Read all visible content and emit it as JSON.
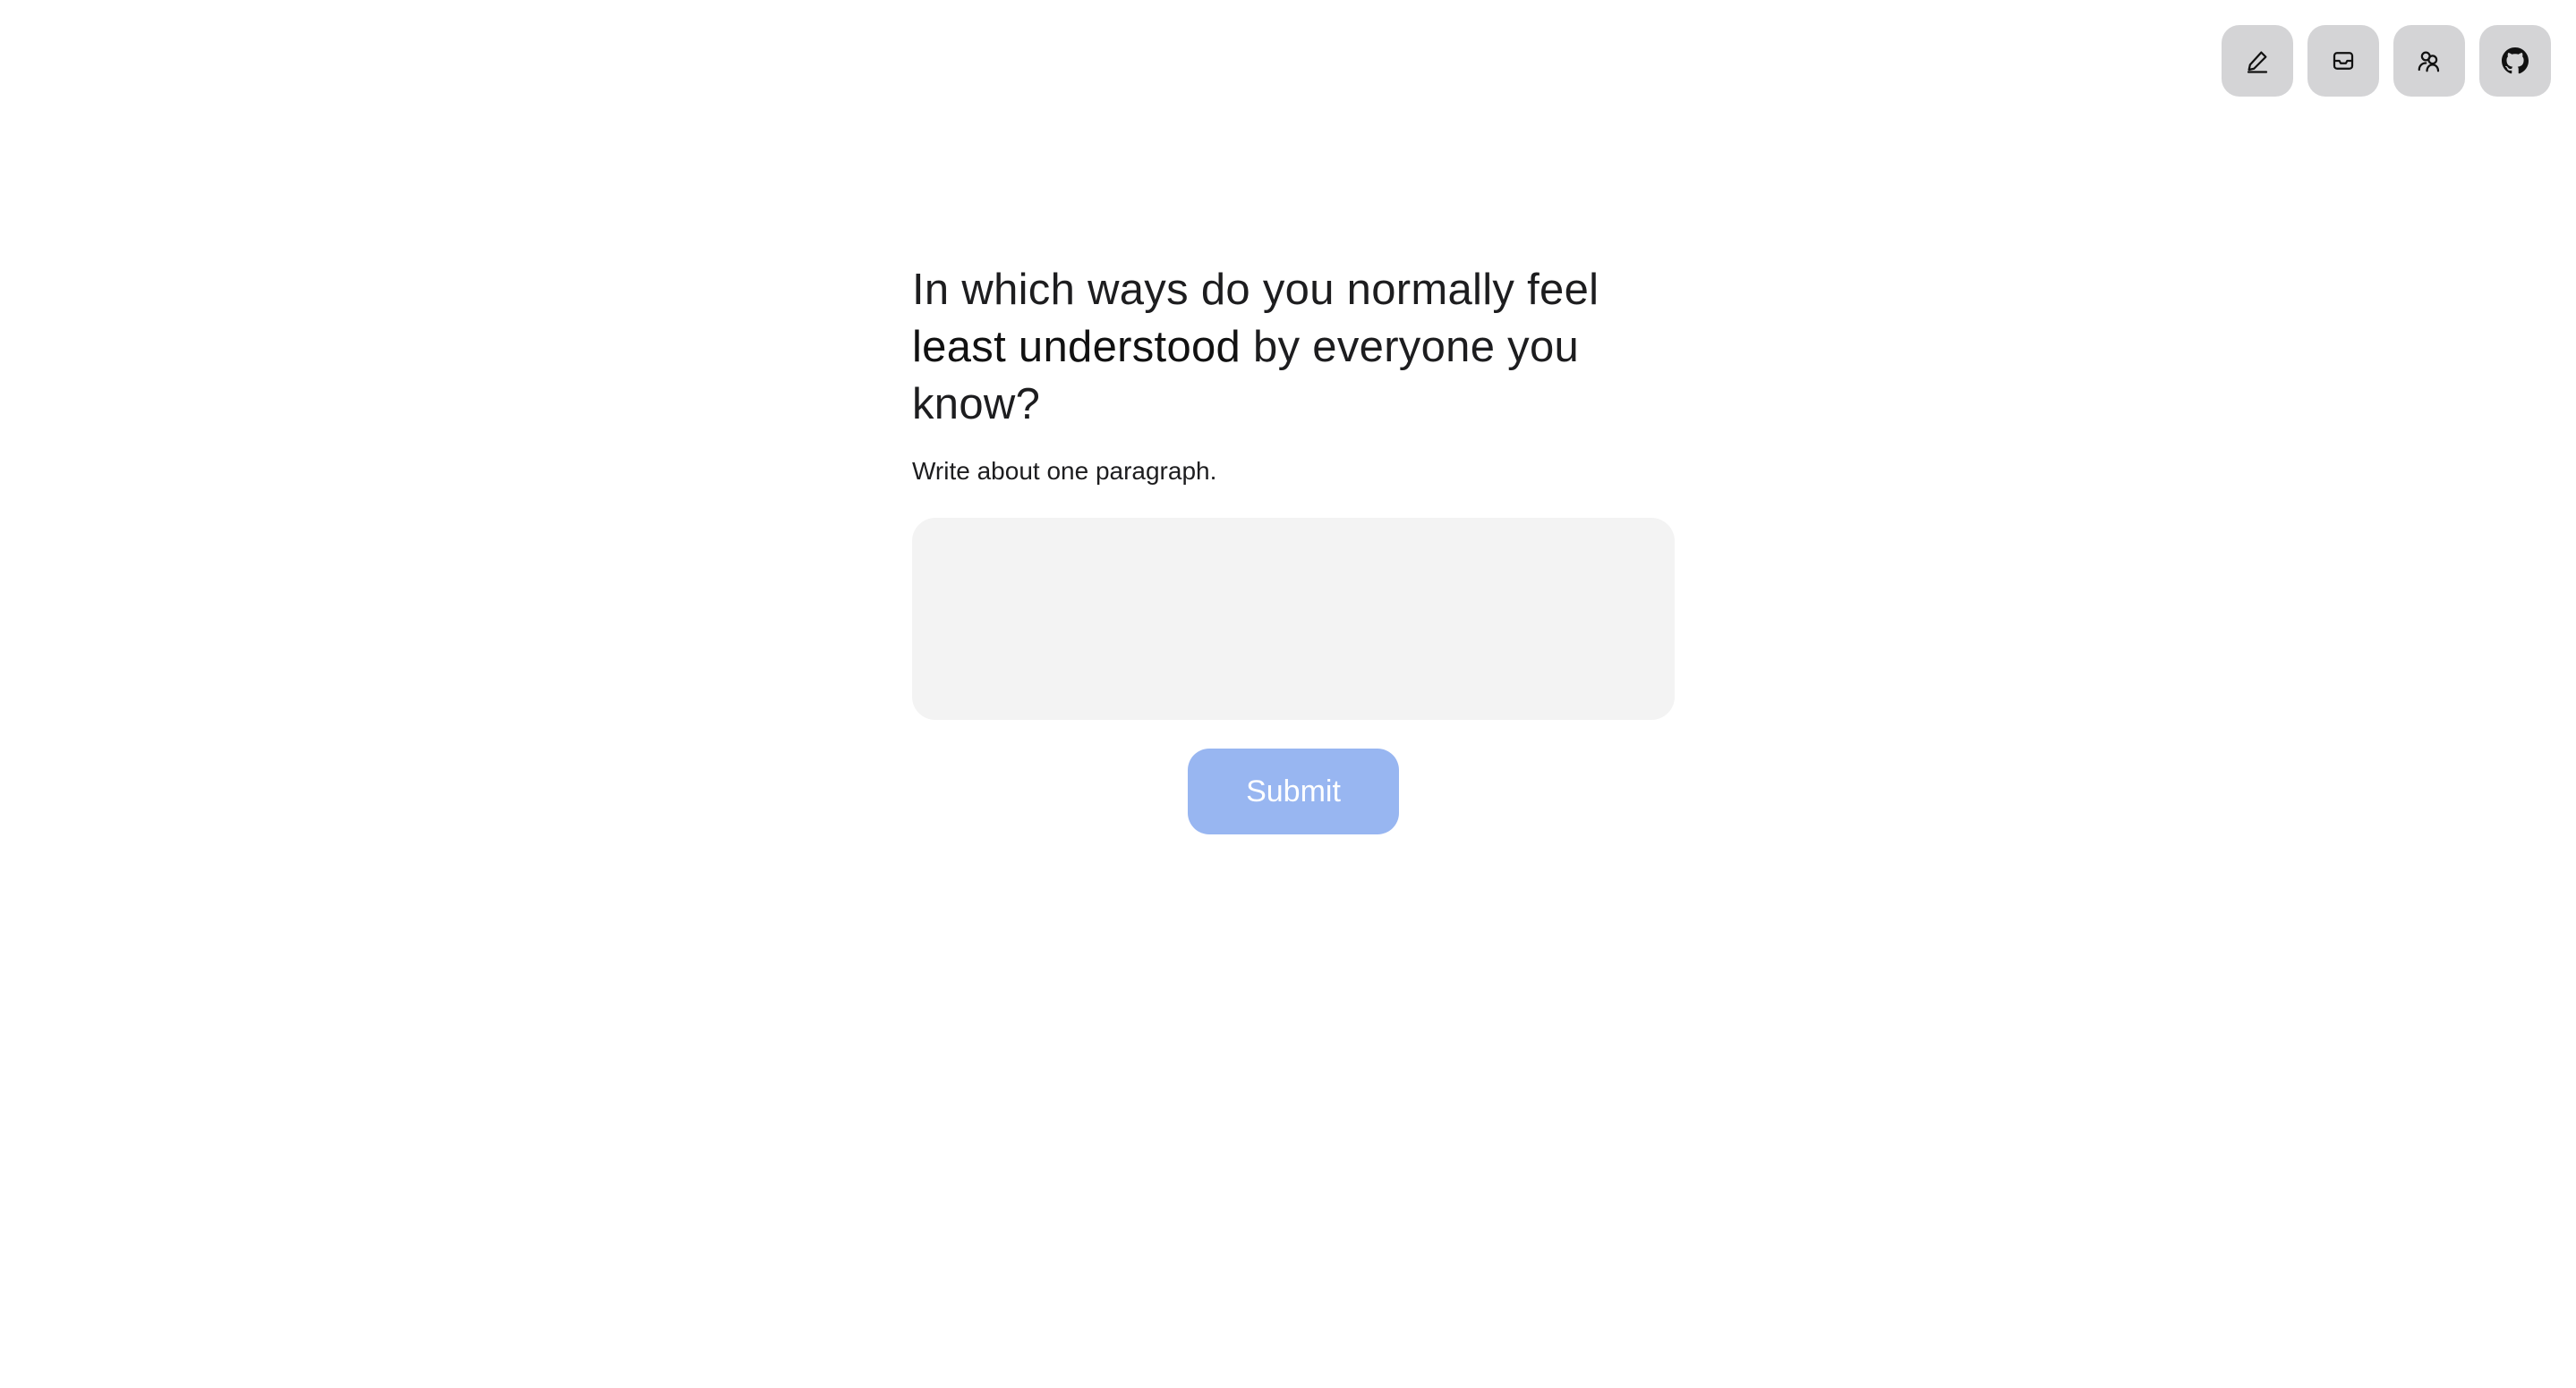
{
  "toolbar": {
    "buttons": [
      {
        "icon": "pencil-icon",
        "label": ""
      },
      {
        "icon": "inbox-icon",
        "label": ""
      },
      {
        "icon": "users-icon",
        "label": ""
      },
      {
        "icon": "github-icon",
        "label": ""
      }
    ]
  },
  "prompt": {
    "question_before": "In which ways do you normally feel ",
    "question_emphasis": "least understood",
    "question_after": " by everyone you know?",
    "hint": "Write about one paragraph."
  },
  "answer": {
    "value": "",
    "placeholder": ""
  },
  "submit": {
    "label": "Submit"
  },
  "colors": {
    "submit_bg": "#98b6f1",
    "icon_button_bg": "#d4d4d6",
    "textarea_bg": "#f3f3f3"
  }
}
